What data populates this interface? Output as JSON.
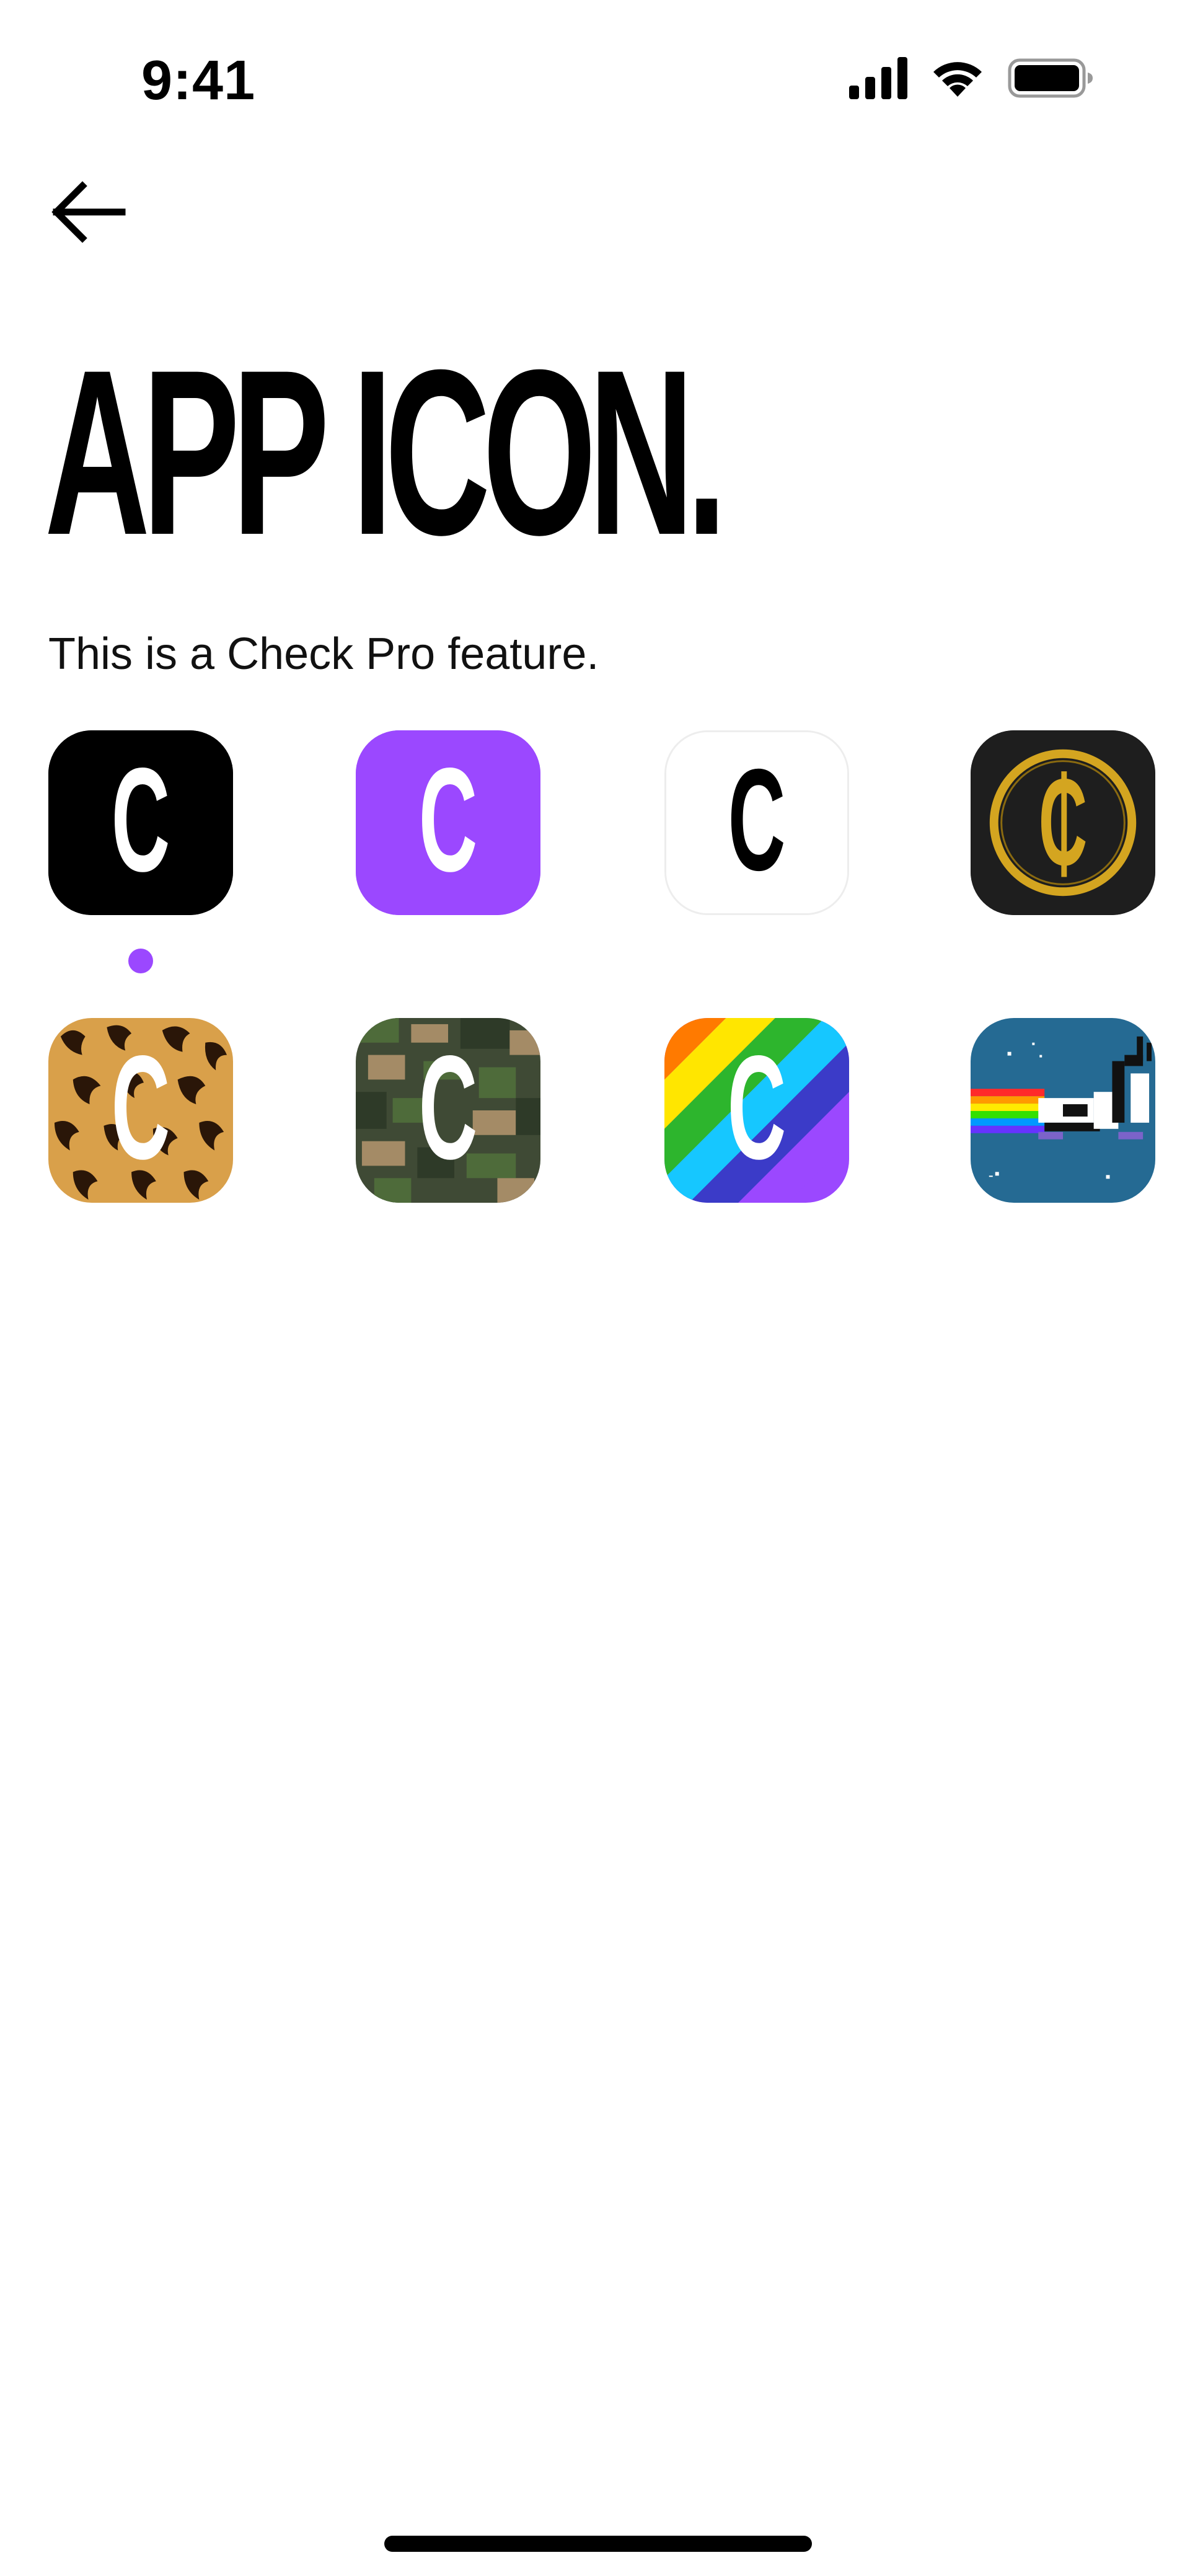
{
  "status_bar": {
    "time": "9:41",
    "icons": [
      "cellular-signal-icon",
      "wifi-icon",
      "battery-icon"
    ]
  },
  "nav": {
    "back_icon": "arrow-left-icon"
  },
  "page": {
    "title": "APP ICON.",
    "subtitle": "This is a Check Pro feature."
  },
  "icons": [
    {
      "name": "black",
      "letter": "C",
      "selected": true
    },
    {
      "name": "purple",
      "letter": "C",
      "selected": false
    },
    {
      "name": "white",
      "letter": "C",
      "selected": false
    },
    {
      "name": "gold-coin",
      "letter": "₵",
      "selected": false
    },
    {
      "name": "leopard",
      "letter": "C",
      "selected": false
    },
    {
      "name": "camo",
      "letter": "C",
      "selected": false
    },
    {
      "name": "rainbow",
      "letter": "C",
      "selected": false
    },
    {
      "name": "nyan-scooter",
      "letter": "",
      "selected": false
    }
  ],
  "colors": {
    "accent": "#9B48FF",
    "black_tile": "#000000",
    "purple_tile": "#9B48FF",
    "gold_tile_bg": "#1E1E1E",
    "gold": "#D4A520",
    "leopard_bg": "#D9A04A",
    "camo_base": "#3F4A35",
    "nyan_bg": "#256A93"
  }
}
